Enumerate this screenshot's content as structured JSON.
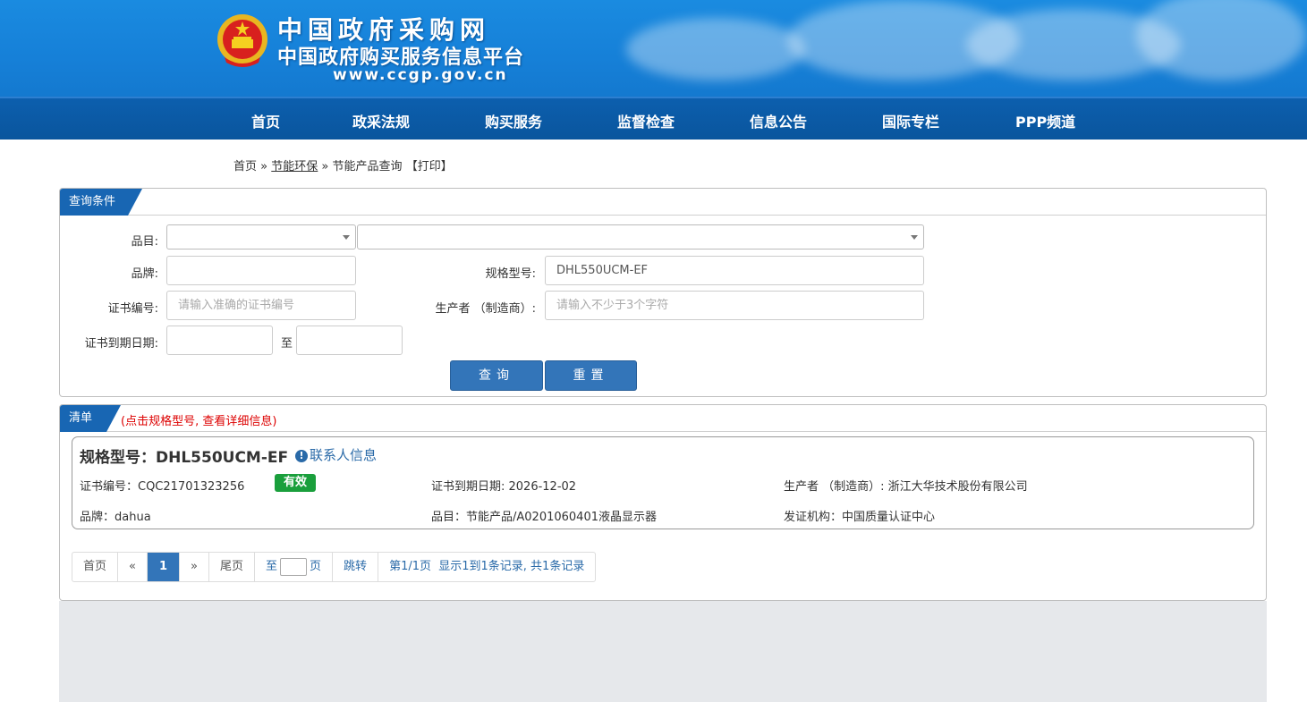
{
  "header": {
    "title": "中国政府采购网",
    "subtitle": "中国政府购买服务信息平台",
    "url": "www.ccgp.gov.cn"
  },
  "nav": [
    "首页",
    "政采法规",
    "购买服务",
    "监督检查",
    "信息公告",
    "国际专栏",
    "PPP频道"
  ],
  "breadcrumb": {
    "home": "首页",
    "sep1": "»",
    "section": "节能环保",
    "sep2": "»",
    "current": "节能产品查询",
    "print": "【打印】"
  },
  "query": {
    "tab": "查询条件",
    "category_label": "品目:",
    "brand_label": "品牌:",
    "brand_value": "",
    "model_label": "规格型号:",
    "model_value": "DHL550UCM-EF",
    "cert_no_label": "证书编号:",
    "cert_no_placeholder": "请输入准确的证书编号",
    "maker_label": "生产者 （制造商）:",
    "maker_placeholder": "请输入不少于3个字符",
    "expiry_label": "证书到期日期:",
    "to_label": "至",
    "search_button": "查询",
    "reset_button": "重置"
  },
  "results": {
    "tab": "清单",
    "note": "(点击规格型号, 查看详细信息)",
    "items": [
      {
        "title": "规格型号：DHL550UCM-EF",
        "contact": "联系人信息",
        "cert_no": "证书编号：CQC21701323256",
        "status": "有效",
        "expiry": "证书到期日期: 2026-12-02",
        "maker": "生产者 （制造商）: 浙江大华技术股份有限公司",
        "brand": "品牌：dahua",
        "category": "品目：节能产品/A0201060401液晶显示器",
        "issuer": "发证机构：中国质量认证中心"
      }
    ]
  },
  "pager": {
    "first": "首页",
    "prev": "«",
    "current": "1",
    "next": "»",
    "last": "尾页",
    "to": "至",
    "page_unit": "页",
    "jump": "跳转",
    "summary": "第1/1页  显示1到1条记录, 共1条记录"
  },
  "colors": {
    "nav_bg": "#0a559d",
    "accent": "#3375b9",
    "status_valid": "#1a9f3c",
    "note_red": "#dd0000"
  }
}
